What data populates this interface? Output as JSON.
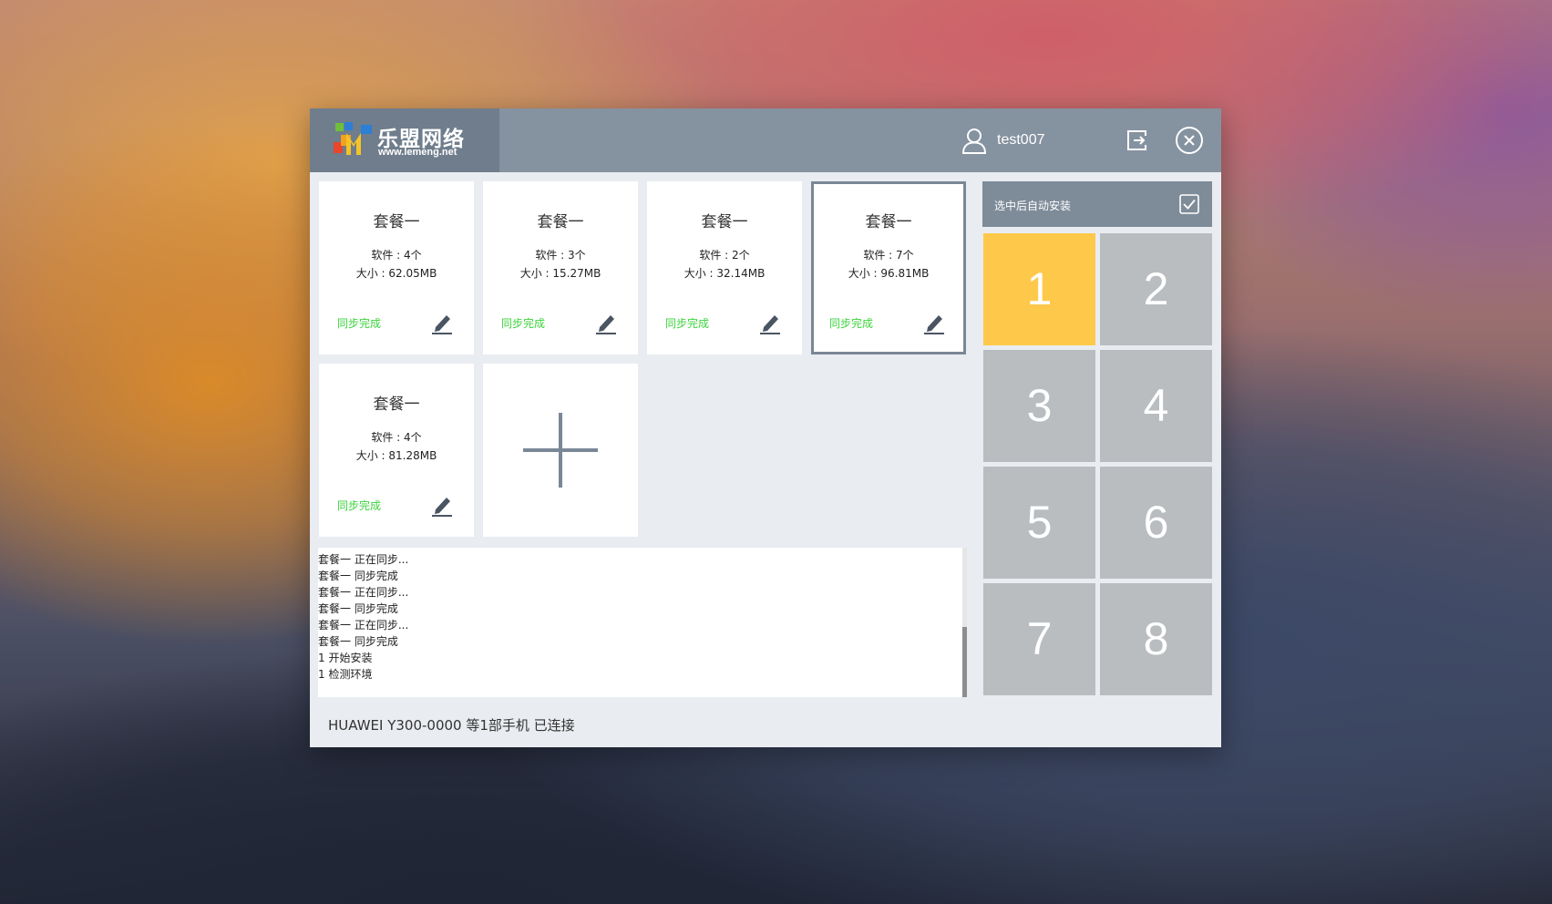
{
  "header": {
    "logo_name": "乐盟网络",
    "logo_url": "www.lemeng.net",
    "username": "test007"
  },
  "packages": [
    {
      "title": "套餐一",
      "software": "软件 : 4个",
      "size": "大小 : 62.05MB",
      "status": "同步完成"
    },
    {
      "title": "套餐一",
      "software": "软件 : 3个",
      "size": "大小 : 15.27MB",
      "status": "同步完成"
    },
    {
      "title": "套餐一",
      "software": "软件 : 2个",
      "size": "大小 : 32.14MB",
      "status": "同步完成"
    },
    {
      "title": "套餐一",
      "software": "软件 : 7个",
      "size": "大小 : 96.81MB",
      "status": "同步完成",
      "selected": true
    },
    {
      "title": "套餐一",
      "software": "软件 : 4个",
      "size": "大小 : 81.28MB",
      "status": "同步完成"
    }
  ],
  "log": [
    "套餐一 正在同步...",
    "套餐一 同步完成",
    "套餐一 正在同步...",
    "套餐一 同步完成",
    "套餐一 正在同步...",
    "套餐一 同步完成",
    "1 开始安装",
    "1 检测环境"
  ],
  "status_bar": "HUAWEI Y300-0000 等1部手机 已连接",
  "auto_install": {
    "label": "选中后自动安装",
    "checked": true
  },
  "slots": [
    "1",
    "2",
    "3",
    "4",
    "5",
    "6",
    "7",
    "8"
  ],
  "active_slot": "1",
  "colors": {
    "titlebar": "#8592a0",
    "logo_block": "#6f7d8c",
    "status_green": "#3bd33b",
    "slot_active": "#fec84a",
    "slot_idle": "#b9bdc0"
  }
}
